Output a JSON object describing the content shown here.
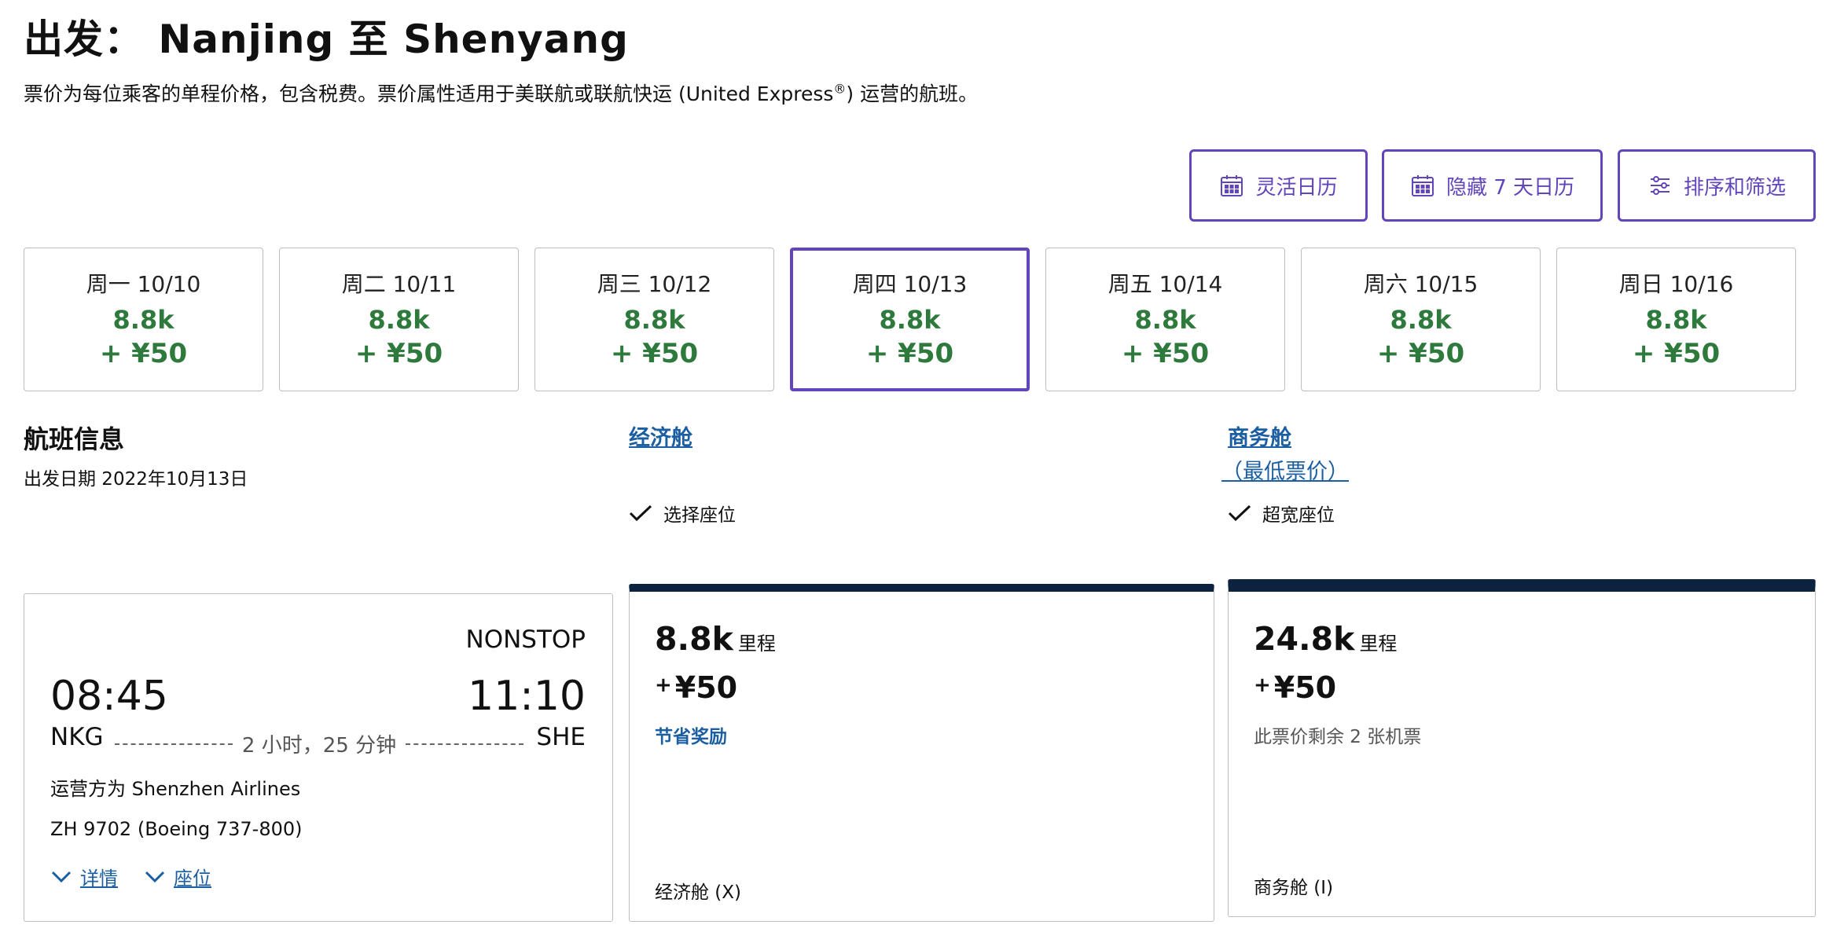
{
  "header": {
    "title": "出发： Nanjing 至 Shenyang",
    "subtitle_pre": "票价为每位乘客的单程价格，包含税费。票价属性适用于美联航或联航快运 (United Express",
    "subtitle_reg": "®",
    "subtitle_post": ") 运营的航班。"
  },
  "toolbar": {
    "flex_calendar": "灵活日历",
    "hide_calendar": "隐藏 7 天日历",
    "sort_filter": "排序和筛选"
  },
  "dates": [
    {
      "label": "周一 10/10",
      "miles": "8.8k",
      "price": "+ ¥50",
      "selected": false
    },
    {
      "label": "周二 10/11",
      "miles": "8.8k",
      "price": "+ ¥50",
      "selected": false
    },
    {
      "label": "周三 10/12",
      "miles": "8.8k",
      "price": "+ ¥50",
      "selected": false
    },
    {
      "label": "周四 10/13",
      "miles": "8.8k",
      "price": "+ ¥50",
      "selected": true
    },
    {
      "label": "周五 10/14",
      "miles": "8.8k",
      "price": "+ ¥50",
      "selected": false
    },
    {
      "label": "周六 10/15",
      "miles": "8.8k",
      "price": "+ ¥50",
      "selected": false
    },
    {
      "label": "周日 10/16",
      "miles": "8.8k",
      "price": "+ ¥50",
      "selected": false
    }
  ],
  "flight_info": {
    "heading": "航班信息",
    "departure_date": "出发日期 2022年10月13日"
  },
  "cabins": {
    "economy": {
      "label": "经济舱",
      "feature": "选择座位"
    },
    "business": {
      "label": "商务舱",
      "sub_label": "（最低票价）",
      "feature": "超宽座位"
    }
  },
  "flight": {
    "stops": "NONSTOP",
    "depart_time": "08:45",
    "arrive_time": "11:10",
    "origin": "NKG",
    "destination": "SHE",
    "duration": "2 小时，25 分钟",
    "operator": "运营方为 Shenzhen Airlines",
    "flight_number": "ZH 9702 (Boeing 737-800)",
    "details_link": "详情",
    "seats_link": "座位"
  },
  "fares": {
    "economy": {
      "miles": "8.8k",
      "miles_unit": "里程",
      "plus": "+",
      "price": "¥50",
      "note": "节省奖励",
      "class": "经济舱 (X)"
    },
    "business": {
      "miles": "24.8k",
      "miles_unit": "里程",
      "plus": "+",
      "price": "¥50",
      "note": "此票价剩余 2 张机票",
      "class": "商务舱 (I)"
    }
  },
  "colors": {
    "accent_purple": "#6244bb",
    "price_green": "#2e7a3d",
    "link_blue": "#1b5fa2",
    "fare_bar_navy": "#0c2340"
  }
}
